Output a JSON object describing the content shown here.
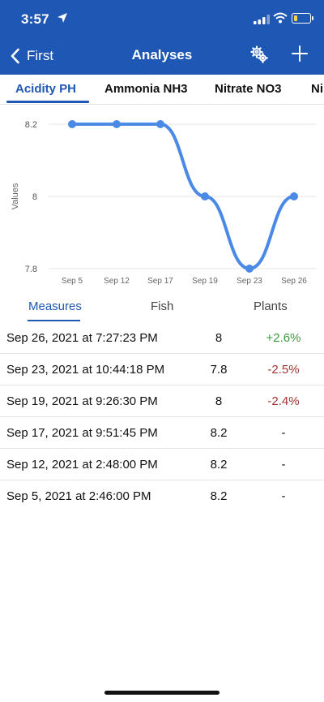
{
  "status_bar": {
    "time": "3:57"
  },
  "nav": {
    "back_label": "First",
    "title": "Analyses"
  },
  "tabs": [
    {
      "label": "Acidity PH"
    },
    {
      "label": "Ammonia NH3"
    },
    {
      "label": "Nitrate NO3"
    },
    {
      "label": "Ni"
    }
  ],
  "colors": {
    "brand": "#1f57b4",
    "line": "#4a8ae6",
    "positive": "#3a9a3a",
    "negative": "#a33333"
  },
  "chart_data": {
    "type": "line",
    "ylabel": "Values",
    "categories": [
      "Sep 5",
      "Sep 12",
      "Sep 17",
      "Sep 19",
      "Sep 23",
      "Sep 26"
    ],
    "series": [
      {
        "values": [
          8.2,
          8.2,
          8.2,
          8.0,
          7.8,
          8.0
        ]
      }
    ],
    "yticks": [
      "8.2",
      "8",
      "7.8"
    ],
    "ylim": [
      7.8,
      8.2
    ],
    "grid": true
  },
  "subtabs": [
    {
      "label": "Measures"
    },
    {
      "label": "Fish"
    },
    {
      "label": "Plants"
    }
  ],
  "measures": [
    {
      "date": "Sep 26, 2021 at 7:27:23 PM",
      "value": "8",
      "change": "+2.6%",
      "trend": "pos"
    },
    {
      "date": "Sep 23, 2021 at 10:44:18 PM",
      "value": "7.8",
      "change": "-2.5%",
      "trend": "neg"
    },
    {
      "date": "Sep 19, 2021 at 9:26:30 PM",
      "value": "8",
      "change": "-2.4%",
      "trend": "neg"
    },
    {
      "date": "Sep 17, 2021 at 9:51:45 PM",
      "value": "8.2",
      "change": "-",
      "trend": "neutral"
    },
    {
      "date": "Sep 12, 2021 at 2:48:00 PM",
      "value": "8.2",
      "change": "-",
      "trend": "neutral"
    },
    {
      "date": "Sep 5, 2021 at 2:46:00 PM",
      "value": "8.2",
      "change": "-",
      "trend": "neutral"
    }
  ]
}
